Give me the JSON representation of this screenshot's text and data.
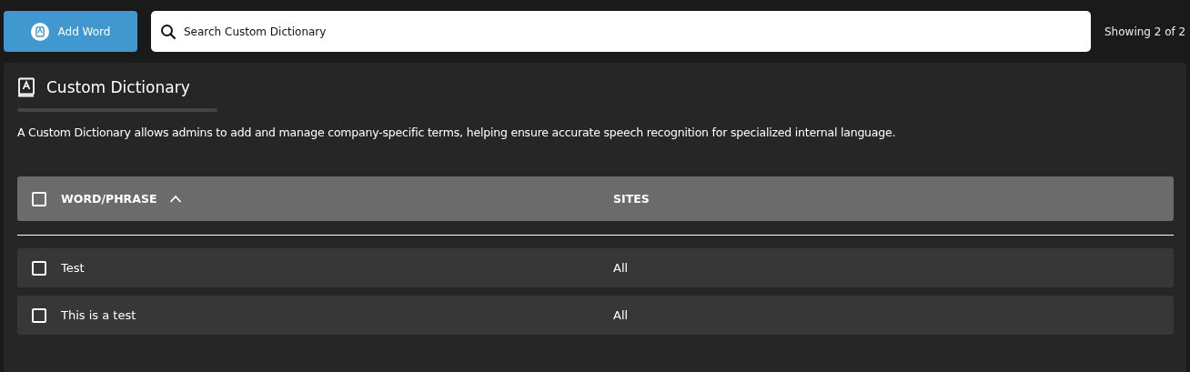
{
  "toolbar": {
    "add_button": "Add Word",
    "search": {
      "placeholder": "Search Custom Dictionary"
    },
    "count": "Showing 2 of 2"
  },
  "panel": {
    "title": "Custom Dictionary",
    "description": "A Custom Dictionary allows admins to add and manage company-specific terms, helping ensure accurate speech recognition for specialized internal language.",
    "table": {
      "select_all": {
        "checked": false
      },
      "columns": [
        {
          "label": "WORD/PHRASE",
          "sorted": true
        },
        {
          "label": "SITES",
          "sorted": false
        }
      ],
      "rows": [
        {
          "checked": false,
          "cells": [
            "Test",
            "All"
          ]
        },
        {
          "checked": false,
          "cells": [
            "This is a test",
            "All"
          ]
        }
      ]
    }
  }
}
